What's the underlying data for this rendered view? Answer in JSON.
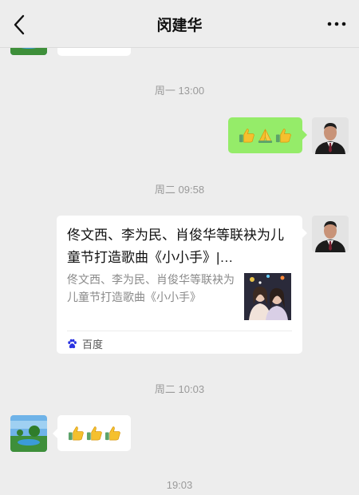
{
  "header": {
    "title": "闵建华",
    "back_icon": "chevron-left-icon",
    "more_icon": "more-horizontal-icon"
  },
  "messages": {
    "timestamp_1": "周一 13:00",
    "sent_reaction_emojis": [
      "thumbs-up",
      "folded-hands",
      "thumbs-up"
    ],
    "timestamp_2": "周二 09:58",
    "link_card": {
      "title": "佟文西、李为民、肖俊华等联袂为儿童节打造歌曲《小小手》|…",
      "description": "佟文西、李为民、肖俊华等联袂为儿童节打造歌曲《小小手》",
      "source": "百度",
      "source_icon": "baidu-paw-icon"
    },
    "timestamp_3": "周二 10:03",
    "received_reaction_emojis": [
      "thumbs-up",
      "thumbs-up",
      "thumbs-up"
    ],
    "timestamp_4": "19:03"
  },
  "colors": {
    "background": "#ededed",
    "sent_bubble": "#95ec69",
    "received_bubble": "#ffffff",
    "timestamp_text": "#9a9a9a",
    "baidu_blue": "#2932e1"
  }
}
